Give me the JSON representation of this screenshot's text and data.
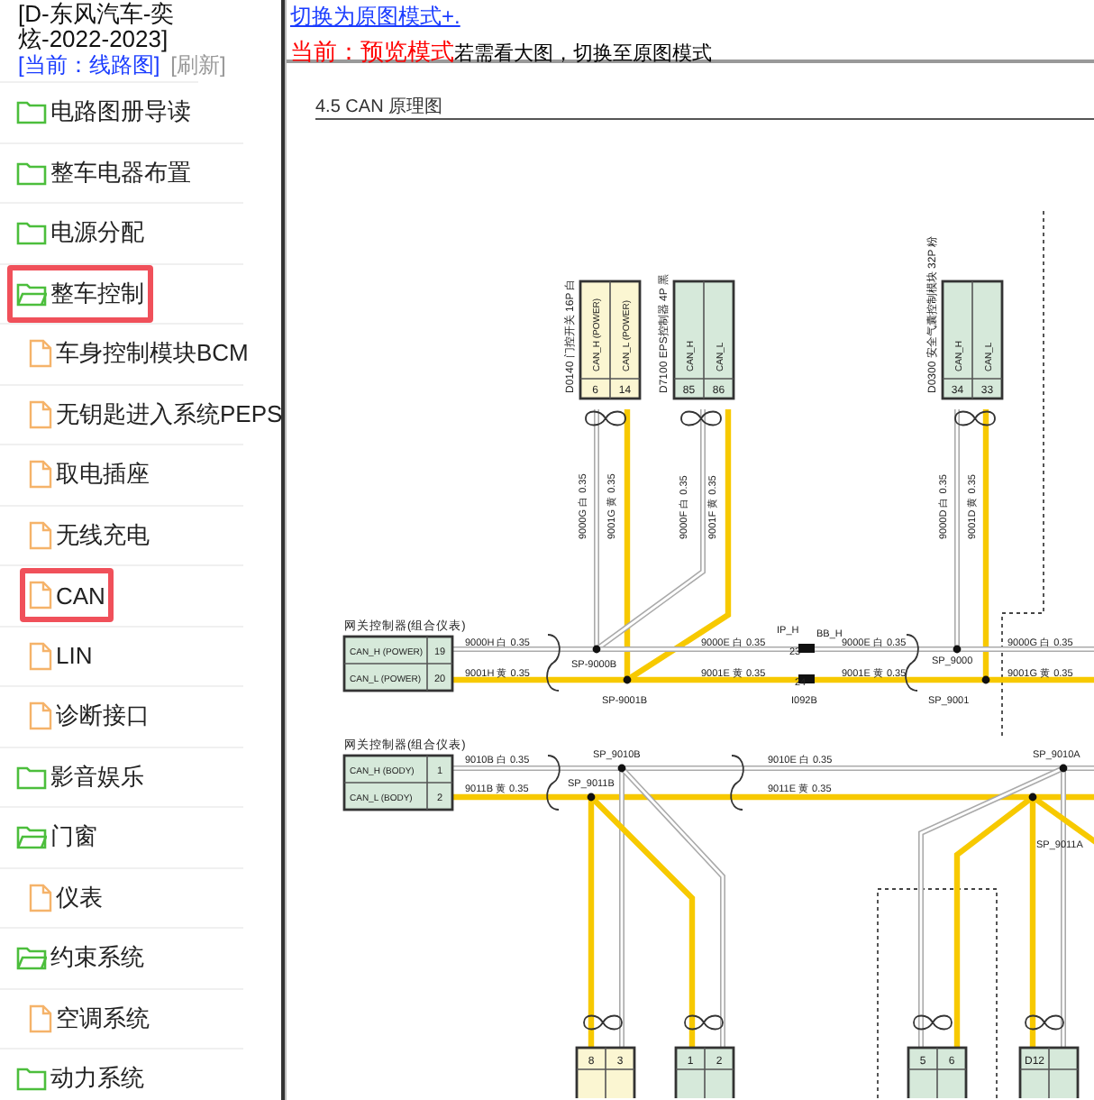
{
  "sidebar": {
    "title": "[D-东风汽车-奕炫-2022-2023]",
    "current": "[当前：线路图]",
    "refresh": "[刷新]",
    "items": [
      {
        "kind": "folder",
        "label": "电路图册导读",
        "expanded": false,
        "selected": false
      },
      {
        "kind": "folder",
        "label": "整车电器布置",
        "expanded": false,
        "selected": false
      },
      {
        "kind": "folder",
        "label": "电源分配",
        "expanded": false,
        "selected": false
      },
      {
        "kind": "folder",
        "label": "整车控制",
        "expanded": true,
        "selected": true,
        "children": [
          {
            "kind": "file",
            "label": "车身控制模块BCM",
            "selected": false
          },
          {
            "kind": "file",
            "label": "无钥匙进入系统PEPS",
            "selected": false
          },
          {
            "kind": "file",
            "label": "取电插座",
            "selected": false
          },
          {
            "kind": "file",
            "label": "无线充电",
            "selected": false
          },
          {
            "kind": "file",
            "label": "CAN",
            "selected": true
          },
          {
            "kind": "file",
            "label": "LIN",
            "selected": false
          },
          {
            "kind": "file",
            "label": "诊断接口",
            "selected": false
          }
        ]
      },
      {
        "kind": "folder",
        "label": "影音娱乐",
        "expanded": false,
        "selected": false
      },
      {
        "kind": "folder",
        "label": "门窗",
        "expanded": true,
        "selected": false,
        "children": [
          {
            "kind": "file",
            "label": "仪表",
            "selected": false
          }
        ]
      },
      {
        "kind": "folder",
        "label": "约束系统",
        "expanded": true,
        "selected": false,
        "children": [
          {
            "kind": "file",
            "label": "空调系统",
            "selected": false
          }
        ]
      },
      {
        "kind": "folder",
        "label": "动力系统",
        "expanded": false,
        "selected": false
      }
    ]
  },
  "view": {
    "switch_link": "切换为原图模式+.",
    "mode_label": "当前：预览模式",
    "mode_hint": "若需看大图，切换至原图模式"
  },
  "diagram": {
    "title": "4.5 CAN 原理图",
    "top_connectors": [
      {
        "name": "D0140 门控开关 16P 白",
        "color": "#fbf6d2",
        "pins": [
          {
            "signal": "CAN_H (POWER)",
            "number": "6"
          },
          {
            "signal": "CAN_L (POWER)",
            "number": "14"
          }
        ]
      },
      {
        "name": "D7100 EPS控制器 4P 黑",
        "color": "#d6e9da",
        "pins": [
          {
            "signal": "CAN_H",
            "number": "85"
          },
          {
            "signal": "CAN_L",
            "number": "86"
          }
        ]
      },
      {
        "name": "D0300 安全气囊控制模块 32P 粉",
        "color": "#d6e9da",
        "pins": [
          {
            "signal": "CAN_H",
            "number": "34"
          },
          {
            "signal": "CAN_L",
            "number": "33"
          }
        ]
      }
    ],
    "gateways": [
      {
        "label": "网关控制器(组合仪表)",
        "pins": [
          {
            "signal": "CAN_H (POWER)",
            "number": "19"
          },
          {
            "signal": "CAN_L (POWER)",
            "number": "20"
          }
        ]
      },
      {
        "label": "网关控制器(组合仪表)",
        "pins": [
          {
            "signal": "CAN_H (BODY)",
            "number": "1"
          },
          {
            "signal": "CAN_L (BODY)",
            "number": "2"
          }
        ]
      }
    ],
    "bottom_connectors": [
      {
        "color": "#fbf6d2",
        "pins": [
          "8",
          "3"
        ]
      },
      {
        "color": "#d6e9da",
        "pins": [
          "1",
          "2"
        ]
      },
      {
        "color": "#d6e9da",
        "pins": [
          "5",
          "6"
        ]
      },
      {
        "color": "#d6e9da",
        "pins": [
          "D12"
        ]
      }
    ],
    "wire_labels": [
      "9000H 白 0.35",
      "9001H 黄 0.35",
      "9000E 白 0.35",
      "9000E 白 0.35",
      "9001E 黄 0.35",
      "9001E 黄 0.35",
      "9000G 白 0.35",
      "9001G 黄 0.35",
      "9010B 白 0.35",
      "9011B 黄 0.35",
      "9010E 白 0.35",
      "9011E 黄 0.35"
    ],
    "vertical_wire_labels": [
      "9000G 白 0.35",
      "9001G 黄 0.35",
      "9000F 白 0.35",
      "9001F 黄 0.35",
      "9000D 白 0.35",
      "9001D 黄 0.35"
    ],
    "splice_labels": [
      "SP-9000B",
      "SP-9001B",
      "SP_9000",
      "SP_9001",
      "SP_9010B",
      "SP_9011B",
      "SP_9010A",
      "SP_9011A"
    ],
    "inline_connector_labels": [
      "IP_H",
      "BB_H",
      "23",
      "24",
      "I092B"
    ]
  }
}
